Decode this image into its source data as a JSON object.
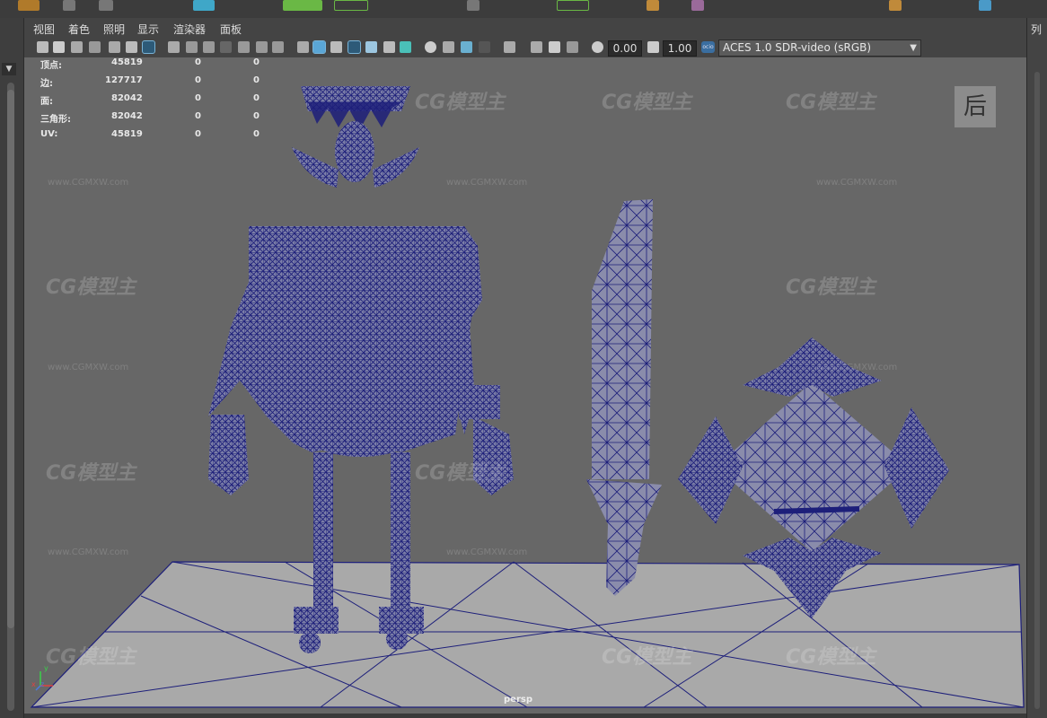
{
  "menubar": {
    "items": [
      {
        "label": "视图"
      },
      {
        "label": "着色"
      },
      {
        "label": "照明"
      },
      {
        "label": "显示"
      },
      {
        "label": "渲染器"
      },
      {
        "label": "面板"
      }
    ]
  },
  "toolbar": {
    "gamma_value": "0.00",
    "exposure_value": "1.00",
    "colorspace_badge": "ocio",
    "colorspace": "ACES 1.0 SDR-video (sRGB)"
  },
  "hud": {
    "rows": [
      {
        "label": "顶点:",
        "v1": "45819",
        "v2": "0",
        "v3": "0"
      },
      {
        "label": "边:",
        "v1": "127717",
        "v2": "0",
        "v3": "0"
      },
      {
        "label": "面:",
        "v1": "82042",
        "v2": "0",
        "v3": "0"
      },
      {
        "label": "三角形:",
        "v1": "82042",
        "v2": "0",
        "v3": "0"
      },
      {
        "label": "UV:",
        "v1": "45819",
        "v2": "0",
        "v3": "0"
      }
    ]
  },
  "viewport": {
    "view_label": "后",
    "camera_name": "persp",
    "axis": {
      "y": "y",
      "x": "x",
      "z": "z"
    }
  },
  "right_panel": {
    "label": "列"
  },
  "watermark": {
    "logo": "CG模型主",
    "url": "www.CGMXW.com"
  },
  "colors": {
    "viewport_bg": "#676767",
    "wireframe": "#1d1f7a",
    "floor": "#a9a9a9",
    "selection": "#79b4d8"
  }
}
